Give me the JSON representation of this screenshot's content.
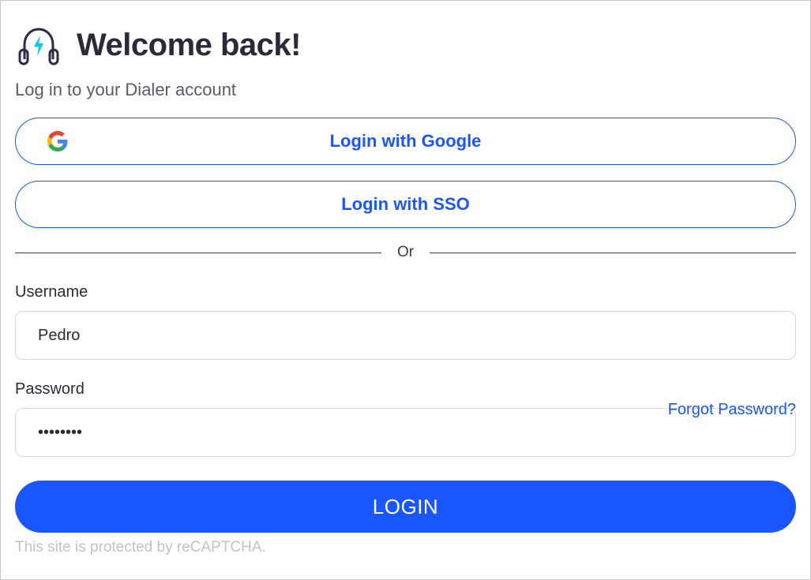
{
  "header": {
    "title": "Welcome back!",
    "subtitle": "Log in to your Dialer account"
  },
  "oauth": {
    "google_label": "Login with Google",
    "sso_label": "Login with SSO"
  },
  "divider": {
    "label": "Or"
  },
  "form": {
    "username_label": "Username",
    "username_value": "Pedro",
    "password_label": "Password",
    "password_value": "••••••••",
    "forgot_label": "Forgot Password?",
    "submit_label": "LOGIN"
  },
  "footer": {
    "recaptcha_text": "This site is protected by reCAPTCHA."
  }
}
